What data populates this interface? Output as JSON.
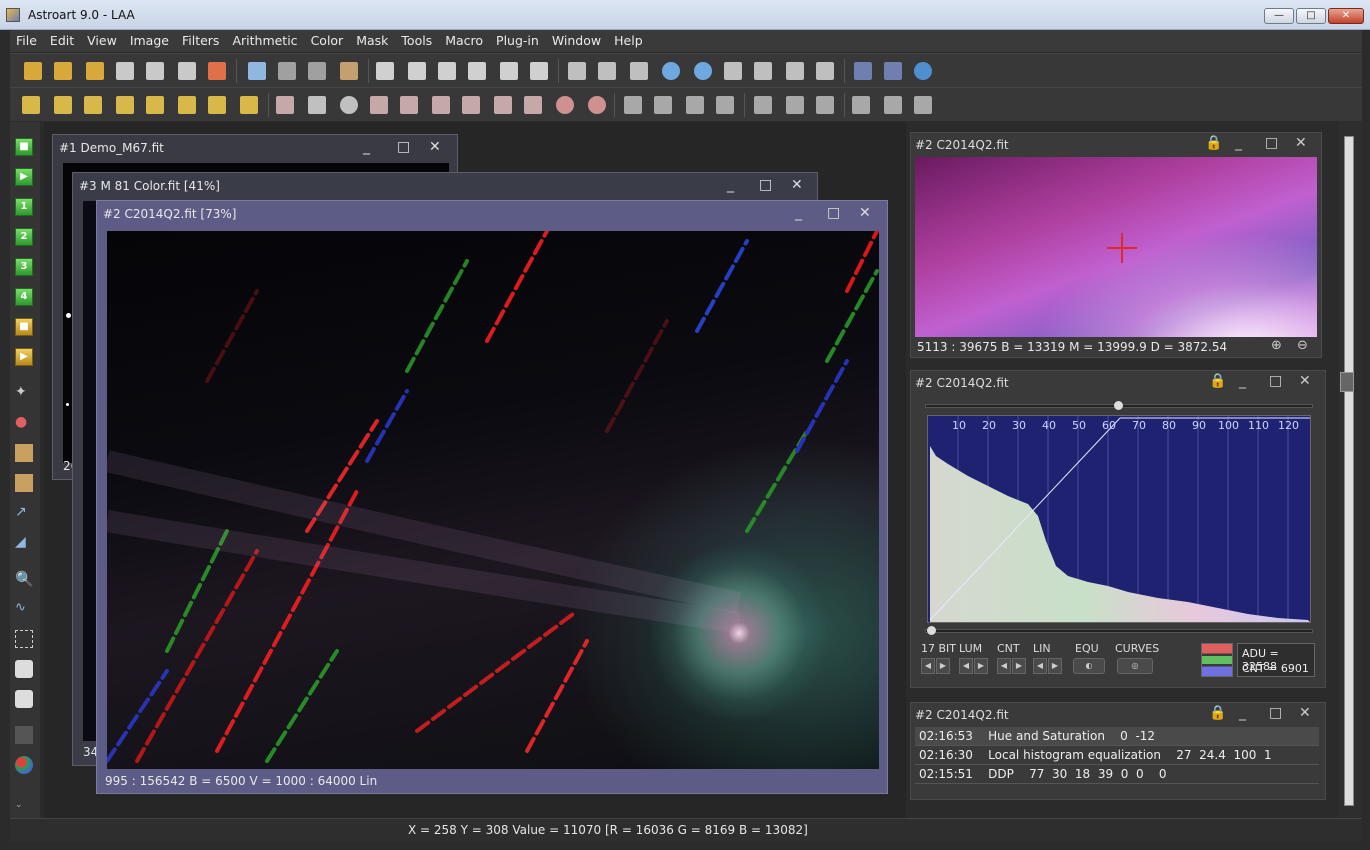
{
  "window": {
    "title": "Astroart 9.0 - LAA",
    "min": "—",
    "max": "□",
    "close": "✕"
  },
  "menu": [
    "File",
    "Edit",
    "View",
    "Image",
    "Filters",
    "Arithmetic",
    "Color",
    "Mask",
    "Tools",
    "Macro",
    "Plug-in",
    "Window",
    "Help"
  ],
  "left_toolbar": {
    "labels": [
      "1",
      "2",
      "3",
      "4"
    ]
  },
  "windows": {
    "m67": {
      "title": "#1 Demo_M67.fit",
      "partial_a": "26",
      "partial_b": "34"
    },
    "m81": {
      "title": "#3 M 81 Color.fit  [41%]"
    },
    "c2014": {
      "title": "#2 C2014Q2.fit  [73%]",
      "status": "995 : 156542     B = 6500     V = 1000 : 64000 Lin"
    }
  },
  "preview_panel": {
    "title": "#2 C2014Q2.fit",
    "status": "5113 : 39675     B = 13319   M = 13999.9   D = 3872.54"
  },
  "histogram_panel": {
    "title": "#2 C2014Q2.fit",
    "axis_ticks": [
      "10",
      "20",
      "30",
      "40",
      "50",
      "60",
      "70",
      "80",
      "90",
      "100",
      "110",
      "120"
    ],
    "controls": [
      "17 BIT",
      "LUM",
      "CNT",
      "LIN",
      "EQU",
      "CURVES"
    ],
    "adu": "ADU = 32588",
    "cnt": "CNT = 6901"
  },
  "history_panel": {
    "title": "#2 C2014Q2.fit",
    "rows": [
      "02:16:53    Hue and Saturation    0  -12",
      "02:16:30    Local histogram equalization    27  24.4  100  1",
      "02:15:51    DDP    77  30  18  39  0  0    0"
    ]
  },
  "status_bar": "X = 258    Y = 308    Value = 11070  [R = 16036   G = 8169   B = 13082]",
  "colors": {
    "panel_bg": "#3a3a3a",
    "histo_bg": "#1f2270",
    "title_active": "#6a6a8a"
  }
}
